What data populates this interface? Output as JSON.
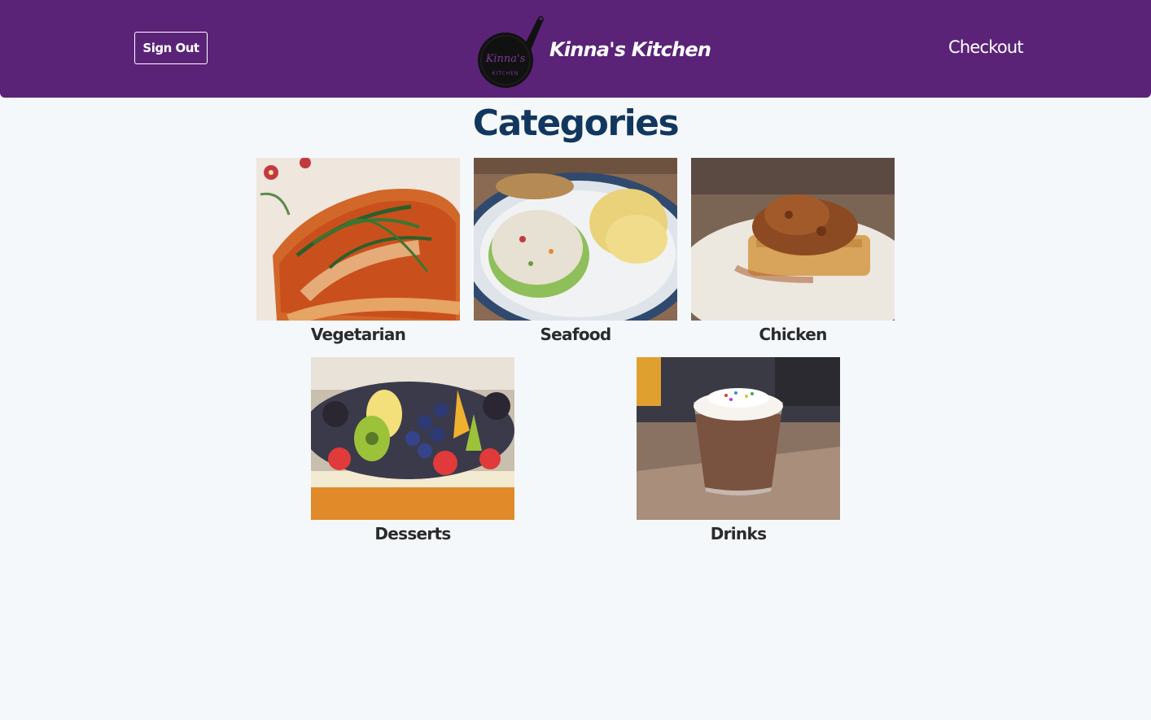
{
  "navbar": {
    "sign_out_label": "Sign Out",
    "brand_name": "Kinna's Kitchen",
    "logo_text_top": "Kinna's",
    "logo_text_bottom": "KITCHEN",
    "checkout_label": "Checkout",
    "background_color": "#5a2378"
  },
  "main": {
    "title": "Categories",
    "categories": [
      {
        "label": "Vegetarian",
        "image": "pizza-slice-with-basil"
      },
      {
        "label": "Seafood",
        "image": "seafood-salad-sandwich-with-chips"
      },
      {
        "label": "Chicken",
        "image": "fried-chicken-on-waffle"
      },
      {
        "label": "Desserts",
        "image": "fruit-tart"
      },
      {
        "label": "Drinks",
        "image": "chocolate-milkshake-with-sprinkles"
      }
    ]
  }
}
